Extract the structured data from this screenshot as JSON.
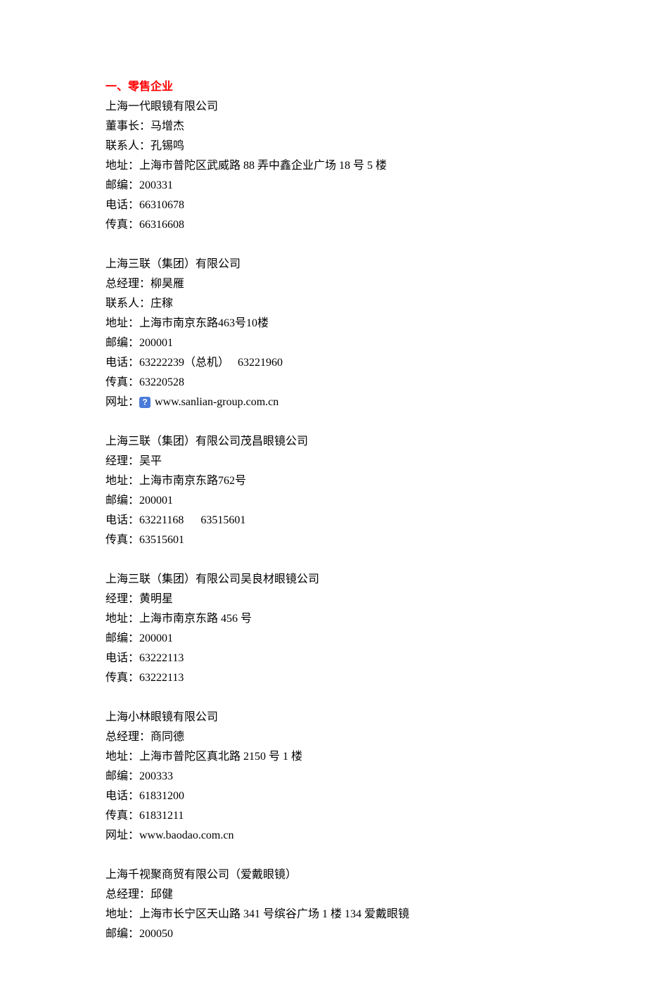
{
  "section_title": "一、零售企业",
  "entries": [
    {
      "name": "上海一代眼镜有限公司",
      "lines": [
        "董事长：马增杰",
        "联系人：孔锡鸣",
        "地址：上海市普陀区武威路 88 弄中鑫企业广场 18 号 5 楼",
        "邮编：200331",
        "电话：66310678",
        "传真：66316608"
      ]
    },
    {
      "name": "上海三联（集团）有限公司",
      "lines": [
        "总经理：柳昊雁",
        "联系人：庄稼",
        "地址：上海市南京东路463号10楼",
        "邮编：200001",
        "电话：63222239（总机）   63221960",
        "传真：63220528"
      ],
      "website_label": "网址：",
      "website_url": "www.sanlian-group.com.cn",
      "has_icon": true
    },
    {
      "name": "上海三联（集团）有限公司茂昌眼镜公司",
      "lines": [
        "经理：吴平",
        "地址：上海市南京东路762号",
        "邮编：200001",
        "电话：63221168      63515601",
        "传真：63515601"
      ]
    },
    {
      "name": "上海三联（集团）有限公司吴良材眼镜公司",
      "lines": [
        "经理：黄明星",
        "地址：上海市南京东路 456 号",
        "邮编：200001",
        "电话：63222113",
        "传真：63222113"
      ]
    },
    {
      "name": "上海小林眼镜有限公司",
      "lines": [
        "总经理：商同德",
        "地址：上海市普陀区真北路 2150 号 1 楼",
        "邮编：200333",
        "电话：61831200",
        "传真：61831211",
        "网址：www.baodao.com.cn"
      ]
    },
    {
      "name": "上海千视聚商贸有限公司（爱戴眼镜）",
      "lines": [
        "总经理：邱健",
        "地址：上海市长宁区天山路 341 号缤谷广场 1 楼 134 爱戴眼镜",
        "邮编：200050"
      ]
    }
  ]
}
